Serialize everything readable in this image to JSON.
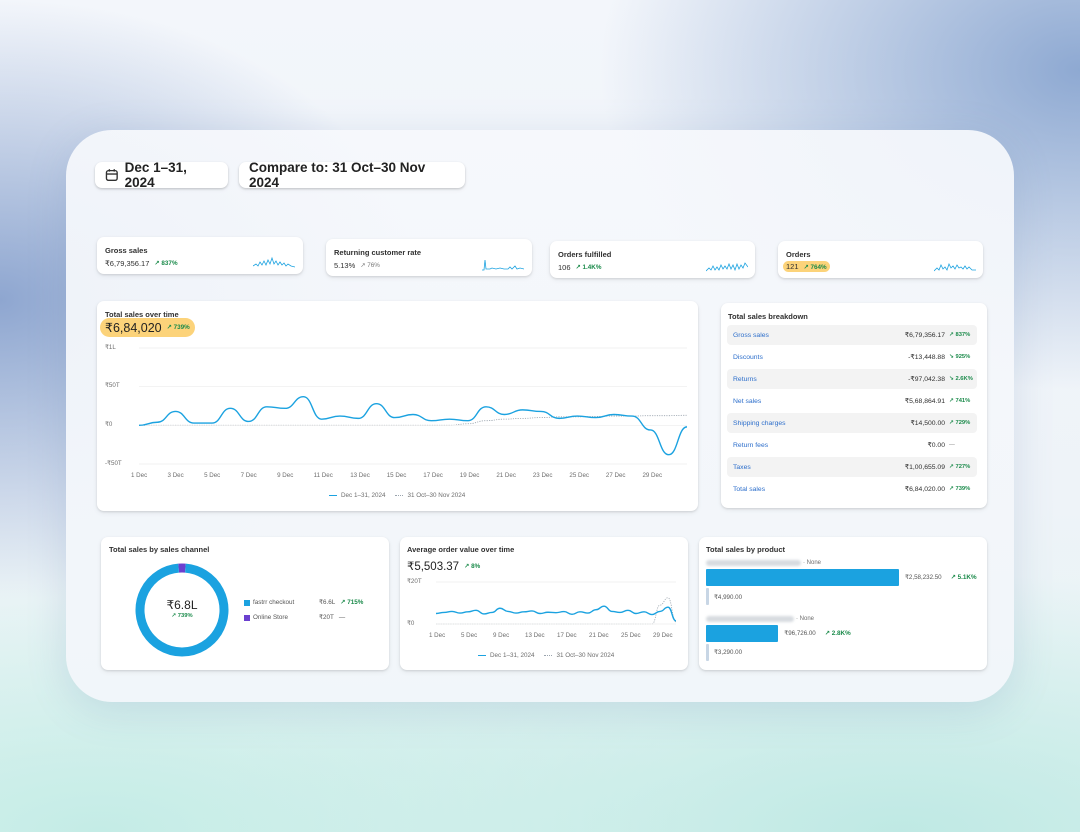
{
  "header": {
    "date_range": "Dec 1–31, 2024",
    "compare": "Compare to: 31 Oct–30 Nov 2024",
    "calendar_icon": "calendar-icon"
  },
  "metrics": [
    {
      "title": "Gross sales",
      "value": "₹6,79,356.17",
      "delta": "↗ 837%"
    },
    {
      "title": "Returning customer rate",
      "value": "5.13%",
      "delta": "↗ 76%"
    },
    {
      "title": "Orders fulfilled",
      "value": "106",
      "delta": "↗ 1.4K%"
    },
    {
      "title": "Orders",
      "value": "121",
      "delta": "↗ 764%"
    }
  ],
  "total_sales": {
    "title": "Total sales over time",
    "value": "₹6,84,020",
    "delta": "↗ 739%",
    "legend_current": "Dec 1–31, 2024",
    "legend_previous": "31 Oct–30 Nov 2024"
  },
  "chart_data": [
    {
      "type": "line",
      "title": "Total sales over time",
      "ylabel": "",
      "xlabel": "",
      "y_ticks": [
        "₹1L",
        "₹50T",
        "₹0",
        "-₹50T"
      ],
      "ylim": [
        -50000,
        100000
      ],
      "x_ticks": [
        "1 Dec",
        "3 Dec",
        "5 Dec",
        "7 Dec",
        "9 Dec",
        "11 Dec",
        "13 Dec",
        "15 Dec",
        "17 Dec",
        "19 Dec",
        "21 Dec",
        "23 Dec",
        "25 Dec",
        "27 Dec",
        "29 Dec"
      ],
      "x": [
        1,
        2,
        3,
        4,
        5,
        6,
        7,
        8,
        9,
        10,
        11,
        12,
        13,
        14,
        15,
        16,
        17,
        18,
        19,
        20,
        21,
        22,
        23,
        24,
        25,
        26,
        27,
        28,
        29,
        30,
        31
      ],
      "series": [
        {
          "name": "Dec 1–31, 2024",
          "color": "#1ba2e0",
          "values": [
            0,
            4000,
            18000,
            3000,
            3000,
            22000,
            5000,
            24000,
            22000,
            37000,
            8000,
            12000,
            9000,
            28000,
            10000,
            14000,
            6000,
            8000,
            6000,
            24000,
            14000,
            20000,
            18000,
            9000,
            12000,
            10000,
            14000,
            12000,
            -6000,
            -38000,
            -2000
          ]
        },
        {
          "name": "31 Oct–30 Nov 2024",
          "color": "#9aa4ae",
          "values": [
            0,
            0,
            0,
            0,
            0,
            0,
            0,
            0,
            0,
            0,
            0,
            0,
            0,
            0,
            0,
            0,
            0,
            0,
            2000,
            6000,
            8000,
            9000,
            10000,
            11000,
            11000,
            11500,
            12000,
            12000,
            12500,
            12500,
            13000
          ]
        }
      ]
    },
    {
      "type": "line",
      "title": "Average order value over time",
      "y_ticks": [
        "₹20T",
        "₹0"
      ],
      "ylim": [
        0,
        20000
      ],
      "x_ticks": [
        "1 Dec",
        "5 Dec",
        "9 Dec",
        "13 Dec",
        "17 Dec",
        "21 Dec",
        "25 Dec",
        "29 Dec"
      ],
      "x": [
        1,
        2,
        3,
        4,
        5,
        6,
        7,
        8,
        9,
        10,
        11,
        12,
        13,
        14,
        15,
        16,
        17,
        18,
        19,
        20,
        21,
        22,
        23,
        24,
        25,
        26,
        27,
        28,
        29,
        30,
        31
      ],
      "series": [
        {
          "name": "Dec 1–31, 2024",
          "color": "#1ba2e0",
          "values": [
            5000,
            5500,
            6000,
            5200,
            5800,
            6500,
            4800,
            5500,
            7500,
            6000,
            5200,
            5800,
            6200,
            5000,
            5600,
            5400,
            5900,
            4600,
            5800,
            5200,
            6800,
            8500,
            6000,
            5500,
            6500,
            5000,
            5800,
            4500,
            6000,
            8000,
            1500
          ]
        },
        {
          "name": "31 Oct–30 Nov 2024",
          "color": "#9aa4ae",
          "values": [
            0,
            0,
            0,
            0,
            0,
            0,
            0,
            0,
            0,
            0,
            0,
            0,
            0,
            0,
            0,
            0,
            0,
            0,
            0,
            0,
            0,
            0,
            0,
            0,
            0,
            0,
            0,
            0,
            9000,
            12500,
            1000
          ]
        }
      ]
    },
    {
      "type": "pie",
      "title": "Total sales by sales channel",
      "center_value": "₹6.8L",
      "center_delta": "↗ 739%",
      "slices": [
        {
          "name": "fastrr checkout",
          "value": 6.8,
          "display": "₹6.6L",
          "delta": "↗ 715%",
          "color": "#1ba2e0"
        },
        {
          "name": "Online Store",
          "value": 0.18,
          "display": "₹20T",
          "delta": "—",
          "color": "#6b40cf"
        }
      ]
    },
    {
      "type": "bar",
      "title": "Total sales by product",
      "categories": [
        "None",
        "None"
      ],
      "series": [
        {
          "name": "Dec 1–31, 2024",
          "values": [
            258232.5,
            96726.0
          ],
          "labels": [
            "₹2,58,232.50",
            "₹96,726.00"
          ],
          "deltas": [
            "↗ 5.1K%",
            "↗ 2.8K%"
          ],
          "color": "#1ba2e0"
        },
        {
          "name": "31 Oct–30 Nov 2024",
          "values": [
            4990.0,
            3290.0
          ],
          "labels": [
            "₹4,990.00",
            "₹3,290.00"
          ],
          "color": "#c8d6e5"
        }
      ]
    }
  ],
  "breakdown": {
    "title": "Total sales breakdown",
    "rows": [
      {
        "label": "Gross sales",
        "value": "₹6,79,356.17",
        "delta": "↗ 837%"
      },
      {
        "label": "Discounts",
        "value": "-₹13,448.88",
        "delta": "↘ 925%"
      },
      {
        "label": "Returns",
        "value": "-₹97,042.38",
        "delta": "↘ 2.6K%"
      },
      {
        "label": "Net sales",
        "value": "₹5,68,864.91",
        "delta": "↗ 741%"
      },
      {
        "label": "Shipping charges",
        "value": "₹14,500.00",
        "delta": "↗ 729%"
      },
      {
        "label": "Return fees",
        "value": "₹0.00",
        "delta": "—"
      },
      {
        "label": "Taxes",
        "value": "₹1,00,655.09",
        "delta": "↗ 727%"
      },
      {
        "label": "Total sales",
        "value": "₹6,84,020.00",
        "delta": "↗ 739%"
      }
    ]
  },
  "channel": {
    "title": "Total sales by sales channel",
    "center_value": "₹6.8L",
    "center_delta": "↗ 739%",
    "items": [
      {
        "name": "fastrr checkout",
        "value": "₹6.6L",
        "delta": "↗ 715%"
      },
      {
        "name": "Online Store",
        "value": "₹20T",
        "delta": "—"
      }
    ]
  },
  "aov": {
    "title": "Average order value over time",
    "value": "₹5,503.37",
    "delta": "↗ 8%",
    "legend_current": "Dec 1–31, 2024",
    "legend_previous": "31 Oct–30 Nov 2024"
  },
  "products": {
    "title": "Total sales by product",
    "rows": [
      {
        "suffix": "· None",
        "value": "₹2,58,232.50",
        "delta": "↗ 5.1K%",
        "prev": "₹4,990.00"
      },
      {
        "suffix": "· None",
        "value": "₹96,726.00",
        "delta": "↗ 2.8K%",
        "prev": "₹3,290.00"
      }
    ]
  }
}
